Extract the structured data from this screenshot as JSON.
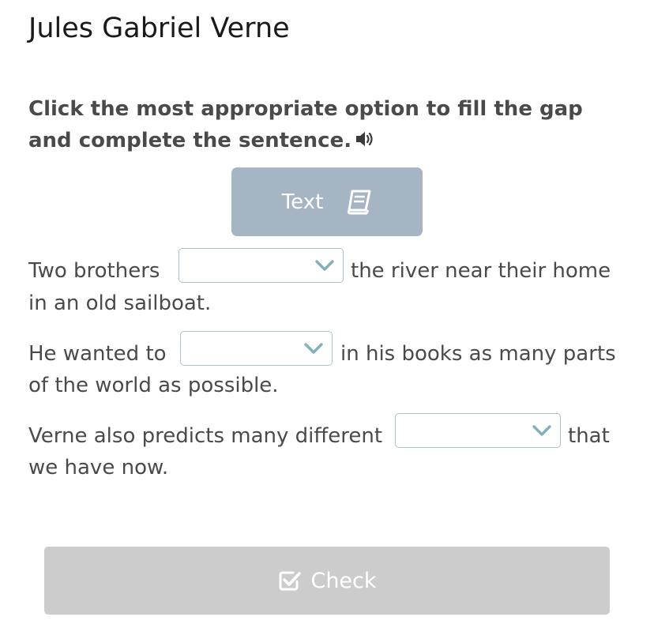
{
  "title": "Jules Gabriel Verne",
  "instruction": {
    "text": "Click the most appropriate option to fill the gap and complete the sentence.",
    "audio_icon": "speaker-icon"
  },
  "text_button": {
    "label": "Text",
    "icon": "book-icon"
  },
  "sentences": [
    {
      "before": "Two brothers",
      "after": "the river near their home",
      "continuation": "in an old sailboat.",
      "selected": ""
    },
    {
      "before": "He wanted to",
      "after": "in his books as many parts",
      "continuation": "of the world as possible.",
      "selected": ""
    },
    {
      "before": "Verne also predicts many different",
      "after": "that",
      "continuation": "we have now.",
      "selected": ""
    }
  ],
  "check_button": {
    "label": "Check",
    "icon": "checkbox-icon"
  },
  "colors": {
    "text_button_bg": "#a5b5c3",
    "check_button_bg": "#cccccc",
    "dropdown_border": "#a9c4c9",
    "chevron": "#7fb0bb"
  }
}
